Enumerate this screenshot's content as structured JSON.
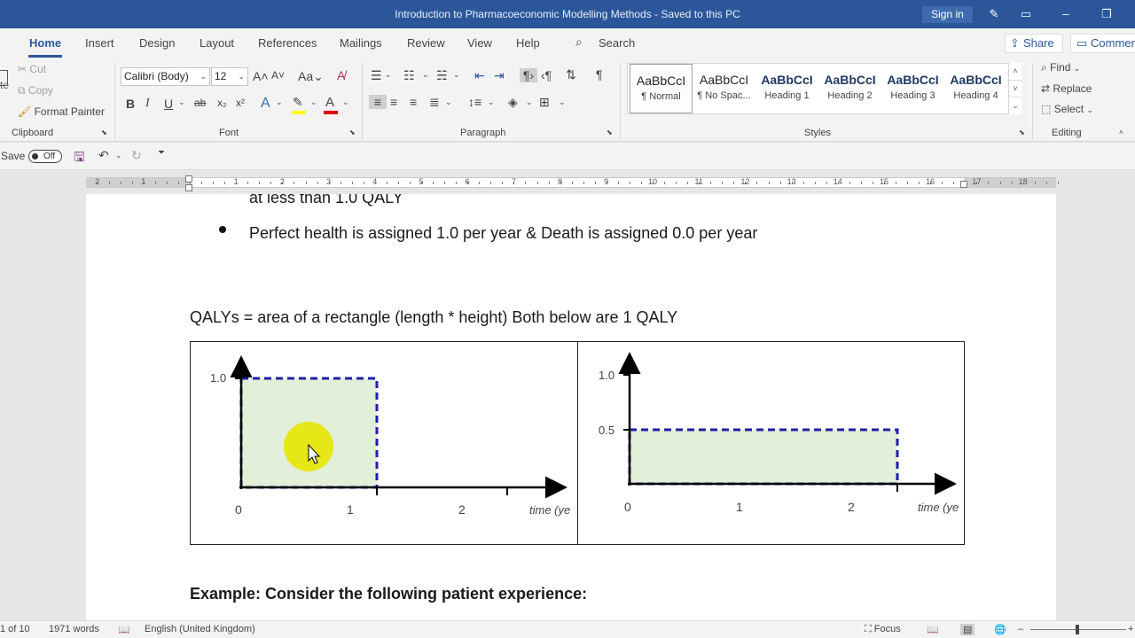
{
  "titlebar": {
    "title": "Introduction to Pharmacoeconomic Modelling Methods  -  Saved to this PC",
    "signin_label": "Sign in"
  },
  "tabs": [
    "Home",
    "Insert",
    "Design",
    "Layout",
    "References",
    "Mailings",
    "Review",
    "View",
    "Help"
  ],
  "search": {
    "label": "Search"
  },
  "share": {
    "label": "Share"
  },
  "comments": {
    "label": "Commer"
  },
  "clipboard": {
    "cut": "Cut",
    "copy": "Copy",
    "format_painter": "Format Painter",
    "paste_fragment": "te",
    "group_label": "Clipboard"
  },
  "font": {
    "name": "Calibri (Body)",
    "size": "12",
    "group_label": "Font",
    "font_color": "#e00000",
    "highlight_color": "#ffff00"
  },
  "paragraph": {
    "group_label": "Paragraph"
  },
  "styles": {
    "group_label": "Styles",
    "items": [
      {
        "sample": "AaBbCcI",
        "name": "¶ Normal"
      },
      {
        "sample": "AaBbCcI",
        "name": "¶ No Spac..."
      },
      {
        "sample": "AaBbCcI",
        "name": "Heading 1"
      },
      {
        "sample": "AaBbCcI",
        "name": "Heading 2"
      },
      {
        "sample": "AaBbCcI",
        "name": "Heading 3"
      },
      {
        "sample": "AaBbCcI",
        "name": "Heading 4"
      }
    ]
  },
  "editing": {
    "find": "Find",
    "replace": "Replace",
    "select": "Select",
    "group_label": "Editing"
  },
  "qat": {
    "autosave_label": "Save",
    "autosave_state": "Off"
  },
  "ruler": {
    "numbers": [
      "2",
      "1",
      "1",
      "2",
      "3",
      "4",
      "5",
      "6",
      "7",
      "8",
      "9",
      "10",
      "11",
      "12",
      "13",
      "14",
      "15",
      "16",
      "17",
      "18"
    ]
  },
  "document": {
    "line_fragment": "at less than 1.0 QALY",
    "bullet_text": "Perfect health is assigned 1.0 per year & Death is assigned 0.0 per year",
    "qaly_line": "QALYs = area of a rectangle (length * height) Both below are 1 QALY",
    "example_heading": "Example: Consider the following patient experience:"
  },
  "figure": {
    "left": {
      "y_labels": [
        "1.0"
      ],
      "x_labels": [
        "0",
        "1",
        "2"
      ],
      "x_axis_title": "time (ye"
    },
    "right": {
      "y_labels": [
        "1.0",
        "0.5"
      ],
      "x_labels": [
        "0",
        "1",
        "2"
      ],
      "x_axis_title": "time (ye"
    },
    "fill_color": "#e2efd9",
    "border_color": "#1f1fa8"
  },
  "status": {
    "page": "1 of 10",
    "words": "1971 words",
    "language": "English (United Kingdom)",
    "focus": "Focus"
  }
}
